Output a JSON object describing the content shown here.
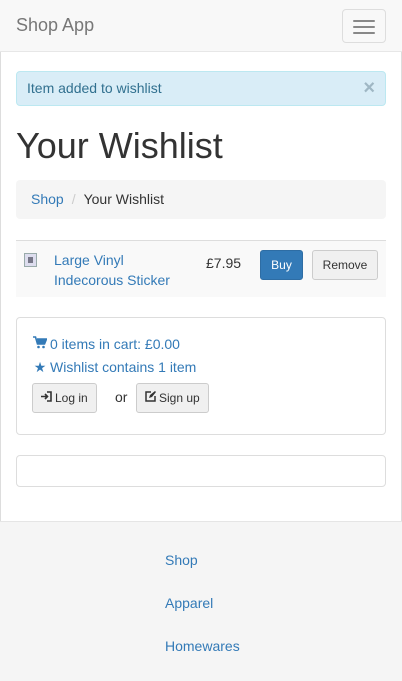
{
  "navbar": {
    "brand": "Shop App"
  },
  "alert": {
    "message": "Item added to wishlist",
    "close": "×"
  },
  "page": {
    "title": "Your Wishlist"
  },
  "breadcrumb": {
    "items": [
      "Shop",
      "Your Wishlist"
    ],
    "separator": "/"
  },
  "wishlist": {
    "items": [
      {
        "name": "Large Vinyl Indecorous Sticker",
        "price": "£7.95",
        "buy_label": "Buy",
        "remove_label": "Remove"
      }
    ]
  },
  "cart_panel": {
    "cart_summary": "0 items in cart: £0.00",
    "wishlist_summary": "Wishlist contains 1 item",
    "login_label": "Log in",
    "or_text": "or",
    "signup_label": "Sign up"
  },
  "footer": {
    "links": [
      "Shop",
      "Apparel",
      "Homewares"
    ]
  },
  "colors": {
    "link": "#337ab7",
    "primary_button": "#337ab7",
    "alert_bg": "#d9edf7",
    "alert_text": "#31708f"
  }
}
